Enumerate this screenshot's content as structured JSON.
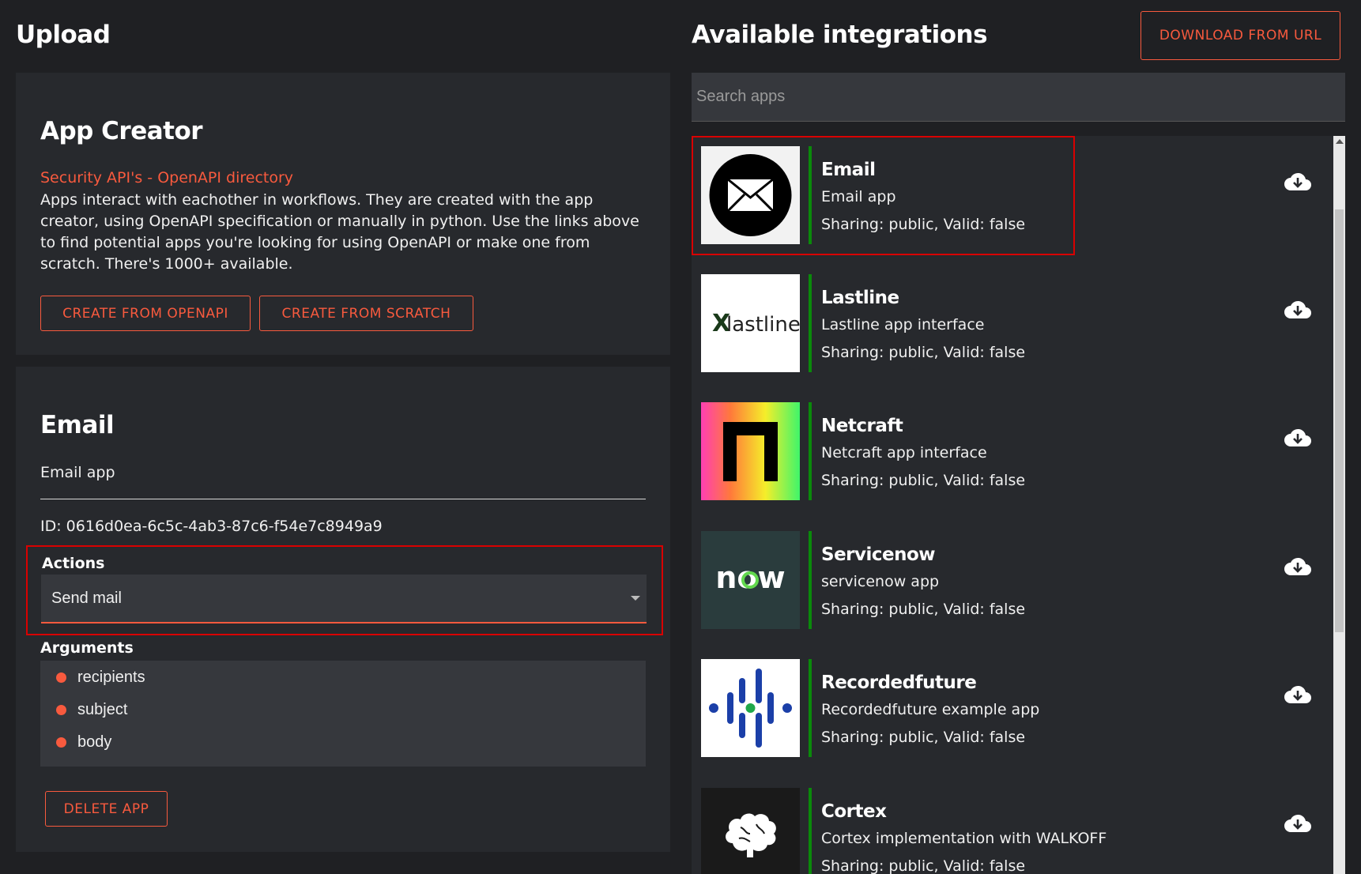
{
  "header": {
    "upload_title": "Upload",
    "available_title": "Available integrations",
    "download_button": "DOWNLOAD FROM URL"
  },
  "creator": {
    "title": "App Creator",
    "link_security": "Security API's",
    "link_separator": " - ",
    "link_openapi": "OpenAPI directory",
    "description": "Apps interact with eachother in workflows. They are created with the app creator, using OpenAPI specification or manually in python. Use the links above to find potential apps you're looking for using OpenAPI or make one from scratch. There's 1000+ available.",
    "btn_openapi": "CREATE FROM OPENAPI",
    "btn_scratch": "CREATE FROM SCRATCH"
  },
  "selected_app": {
    "title": "Email",
    "description": "Email app",
    "id": "ID: 0616d0ea-6c5c-4ab3-87c6-f54e7c8949a9",
    "actions_label": "Actions",
    "action_selected": "Send mail",
    "arguments_label": "Arguments",
    "arguments": [
      "recipients",
      "subject",
      "body"
    ],
    "delete_button": "DELETE APP"
  },
  "search": {
    "placeholder": "Search apps"
  },
  "apps": [
    {
      "name": "Email",
      "description": "Email app",
      "sharing": "Sharing: public, Valid: false",
      "icon": "envelope-icon"
    },
    {
      "name": "Lastline",
      "description": "Lastline app interface",
      "sharing": "Sharing: public, Valid: false",
      "icon": "lastline-logo",
      "logo_text": "lastline"
    },
    {
      "name": "Netcraft",
      "description": "Netcraft app interface",
      "sharing": "Sharing: public, Valid: false",
      "icon": "netcraft-logo"
    },
    {
      "name": "Servicenow",
      "description": "servicenow app",
      "sharing": "Sharing: public, Valid: false",
      "icon": "servicenow-logo",
      "logo_text": "now"
    },
    {
      "name": "Recordedfuture",
      "description": "Recordedfuture example app",
      "sharing": "Sharing: public, Valid: false",
      "icon": "recordedfuture-logo"
    },
    {
      "name": "Cortex",
      "description": "Cortex implementation with WALKOFF",
      "sharing": "Sharing: public, Valid: false",
      "icon": "brain-icon"
    }
  ],
  "colors": {
    "accent": "#f85a3e",
    "highlight": "#d90000",
    "valid_bar": "#0a8a0a",
    "background": "#1f2023",
    "panel": "#27292d"
  }
}
